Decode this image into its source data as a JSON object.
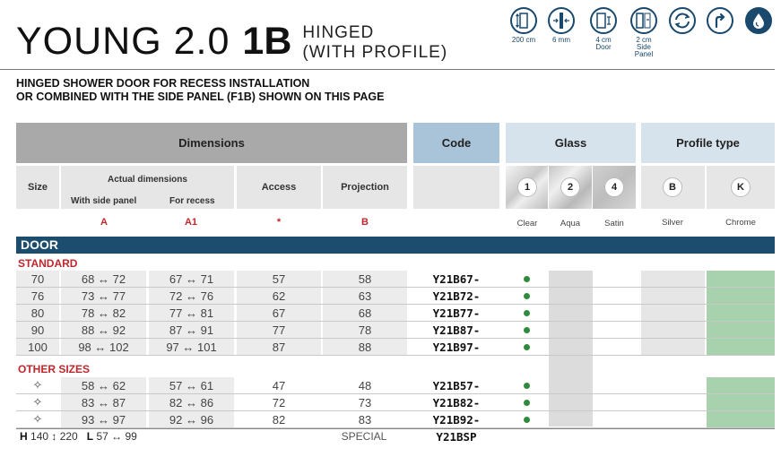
{
  "header": {
    "title_main": "YOUNG 2.0",
    "title_code": "1B",
    "subtitle_line1": "HINGED",
    "subtitle_line2": "(WITH PROFILE)"
  },
  "icons": [
    {
      "name": "height-icon",
      "label": "200 cm"
    },
    {
      "name": "glass-thickness-icon",
      "label": "6 mm"
    },
    {
      "name": "door-adjust-icon",
      "label": "4 cm\nDoor"
    },
    {
      "name": "side-panel-adjust-icon",
      "label": "2 cm\nSide Panel"
    },
    {
      "name": "reversible-icon",
      "label": ""
    },
    {
      "name": "hand-icon",
      "label": ""
    },
    {
      "name": "water-drop-icon",
      "label": ""
    }
  ],
  "description": {
    "line1": "HINGED SHOWER DOOR FOR RECESS INSTALLATION",
    "line2": "OR COMBINED WITH THE SIDE PANEL (F1B) SHOWN ON THIS PAGE"
  },
  "table_header": {
    "dimensions": "Dimensions",
    "code": "Code",
    "glass": "Glass",
    "profile_type": "Profile type",
    "size": "Size",
    "actual_dimensions": "Actual dimensions",
    "with_side_panel": "With side panel",
    "for_recess": "For recess",
    "access": "Access",
    "projection": "Projection",
    "letters": {
      "with_side_panel": "A",
      "for_recess": "A1",
      "access": "*",
      "projection": "B"
    },
    "glass_options": [
      {
        "number": "1",
        "label": "Clear"
      },
      {
        "number": "2",
        "label": "Aqua"
      },
      {
        "number": "4",
        "label": "Satin"
      }
    ],
    "profile_options": [
      {
        "letter": "B",
        "label": "Silver"
      },
      {
        "letter": "K",
        "label": "Chrome"
      }
    ]
  },
  "door_label": "DOOR",
  "sections": [
    {
      "title": "STANDARD",
      "rows": [
        {
          "size": "70",
          "with_side_panel": "68 ↔ 72",
          "for_recess": "67 ↔ 71",
          "access": "57",
          "projection": "58",
          "code": "Y21B67-"
        },
        {
          "size": "76",
          "with_side_panel": "73 ↔ 77",
          "for_recess": "72 ↔ 76",
          "access": "62",
          "projection": "63",
          "code": "Y21B72-"
        },
        {
          "size": "80",
          "with_side_panel": "78 ↔ 82",
          "for_recess": "77 ↔ 81",
          "access": "67",
          "projection": "68",
          "code": "Y21B77-"
        },
        {
          "size": "90",
          "with_side_panel": "88 ↔ 92",
          "for_recess": "87 ↔ 91",
          "access": "77",
          "projection": "78",
          "code": "Y21B87-"
        },
        {
          "size": "100",
          "with_side_panel": "98 ↔ 102",
          "for_recess": "97 ↔ 101",
          "access": "87",
          "projection": "88",
          "code": "Y21B97-"
        }
      ]
    },
    {
      "title": "OTHER SIZES",
      "rows": [
        {
          "size": "✧",
          "with_side_panel": "58 ↔ 62",
          "for_recess": "57 ↔ 61",
          "access": "47",
          "projection": "48",
          "code": "Y21B57-"
        },
        {
          "size": "✧",
          "with_side_panel": "83 ↔ 87",
          "for_recess": "82 ↔ 86",
          "access": "72",
          "projection": "73",
          "code": "Y21B82-"
        },
        {
          "size": "✧",
          "with_side_panel": "93 ↔ 97",
          "for_recess": "92 ↔ 96",
          "access": "82",
          "projection": "83",
          "code": "Y21B92-"
        }
      ]
    }
  ],
  "footer": {
    "h_letter": "H",
    "h_range": "140 ↕ 220",
    "l_letter": "L",
    "l_range": "57 ↔ 99",
    "special": "SPECIAL",
    "code": "Y21BSP"
  },
  "colors": {
    "brand_blue": "#1c4d6e",
    "accent_red": "#c0272d",
    "header_gray": "#a9a9a9",
    "code_blue": "#a9c4d8",
    "glass_light": "#d7e3ec",
    "available_dot": "#2f8a3c",
    "chrome_green": "#a7d2ad"
  }
}
